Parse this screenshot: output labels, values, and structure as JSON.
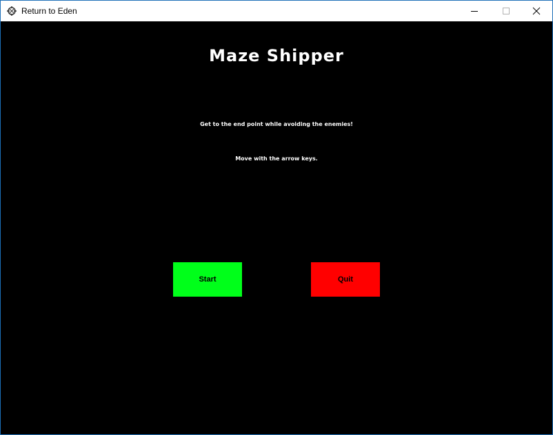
{
  "window": {
    "title": "Return to Eden",
    "app_icon": "game-app-icon",
    "controls": [
      "minimize-icon",
      "maximize-icon",
      "close-icon"
    ]
  },
  "game": {
    "title": "Maze Shipper",
    "instructions": [
      "Get to the end point while avoiding the enemies!",
      "Move with the arrow keys."
    ],
    "buttons": {
      "start": {
        "label": "Start",
        "color": "#00ff1a"
      },
      "quit": {
        "label": "Quit",
        "color": "#ff0000"
      }
    },
    "background": "#000000"
  }
}
